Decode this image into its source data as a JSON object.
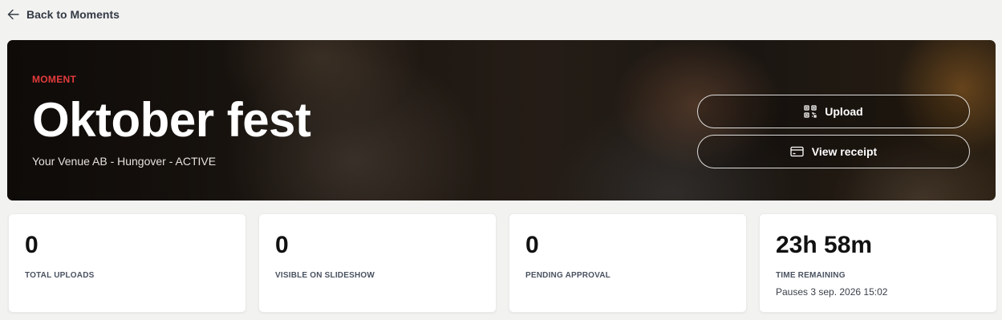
{
  "nav": {
    "back_label": "Back to Moments"
  },
  "hero": {
    "eyebrow": "MOMENT",
    "title": "Oktober fest",
    "subtitle": "Your Venue AB - Hungover - ACTIVE",
    "upload_label": "Upload",
    "receipt_label": "View receipt"
  },
  "stats": [
    {
      "value": "0",
      "label": "TOTAL UPLOADS"
    },
    {
      "value": "0",
      "label": "VISIBLE ON SLIDESHOW"
    },
    {
      "value": "0",
      "label": "PENDING APPROVAL"
    },
    {
      "value": "23h 58m",
      "label": "TIME REMAINING",
      "note": "Pauses 3 sep. 2026 15:02"
    }
  ],
  "colors": {
    "accent": "#e43c3c",
    "background": "#f2f2f1"
  },
  "icons": {
    "back": "arrow-left-icon",
    "upload": "qr-code-icon",
    "receipt": "credit-card-icon"
  }
}
